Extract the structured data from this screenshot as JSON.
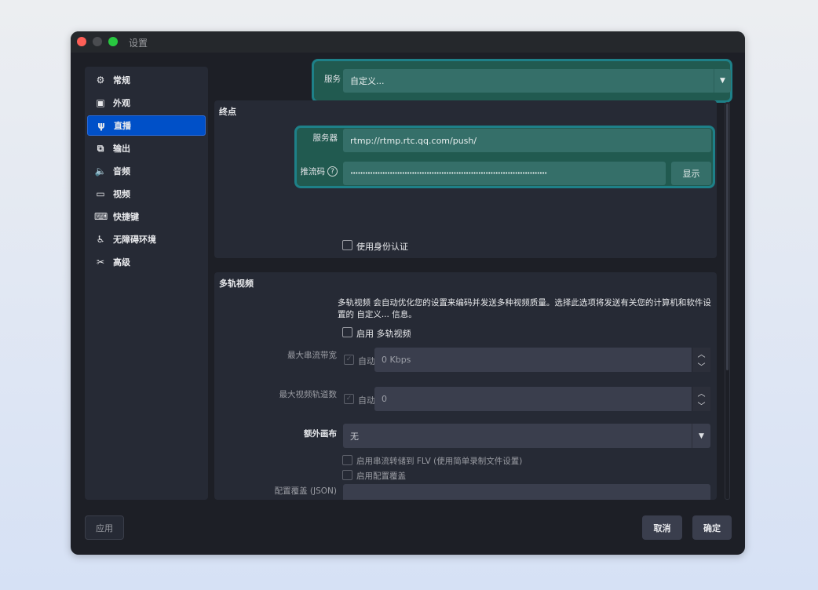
{
  "window": {
    "title": "设置",
    "controls": {
      "close": "#fe5f57",
      "minimize": "#4a4c50",
      "zoom": "#28c840"
    }
  },
  "sidebar": {
    "items": [
      {
        "label": "常规",
        "icon": "gear-icon",
        "glyph": "⚙"
      },
      {
        "label": "外观",
        "icon": "appearance-icon",
        "glyph": "▣"
      },
      {
        "label": "直播",
        "icon": "antenna-icon",
        "glyph": "ψ",
        "selected": true
      },
      {
        "label": "输出",
        "icon": "output-icon",
        "glyph": "⧉"
      },
      {
        "label": "音频",
        "icon": "speaker-icon",
        "glyph": "🔈"
      },
      {
        "label": "视频",
        "icon": "monitor-icon",
        "glyph": "▭"
      },
      {
        "label": "快捷键",
        "icon": "keyboard-icon",
        "glyph": "⌨"
      },
      {
        "label": "无障碍环境",
        "icon": "accessibility-icon",
        "glyph": "♿"
      },
      {
        "label": "高级",
        "icon": "tools-icon",
        "glyph": "✂"
      }
    ]
  },
  "service": {
    "label": "服务",
    "value": "自定义..."
  },
  "endpoint": {
    "title": "终点",
    "server_label": "服务器",
    "server_value": "rtmp://rtmp.rtc.qq.com/push/",
    "key_label": "推流码",
    "key_value": "••••••••••••••••••••••••••••••••••••••••••••••••••••••••••••••••••••••••••••••••",
    "show_label": "显示",
    "auth_label": "使用身份认证"
  },
  "multitrack": {
    "title": "多轨视频",
    "description": "多轨视频 会自动优化您的设置来编码并发送多种视频质量。选择此选项将发送有关您的计算机和软件设置的 自定义... 信息。",
    "enable_label": "启用 多轨视频",
    "bandwidth_label": "最大串流带宽",
    "bandwidth_auto": "自动",
    "bandwidth_value": "0 Kbps",
    "tracks_label": "最大视频轨道数",
    "tracks_auto": "自动",
    "tracks_value": "0",
    "canvas_label": "额外画布",
    "canvas_value": "无",
    "flv_label": "启用串流转储到 FLV (使用简单录制文件设置)",
    "override_label": "启用配置覆盖",
    "json_label": "配置覆盖 (JSON)"
  },
  "buttons": {
    "apply": "应用",
    "cancel": "取消",
    "ok": "确定"
  }
}
